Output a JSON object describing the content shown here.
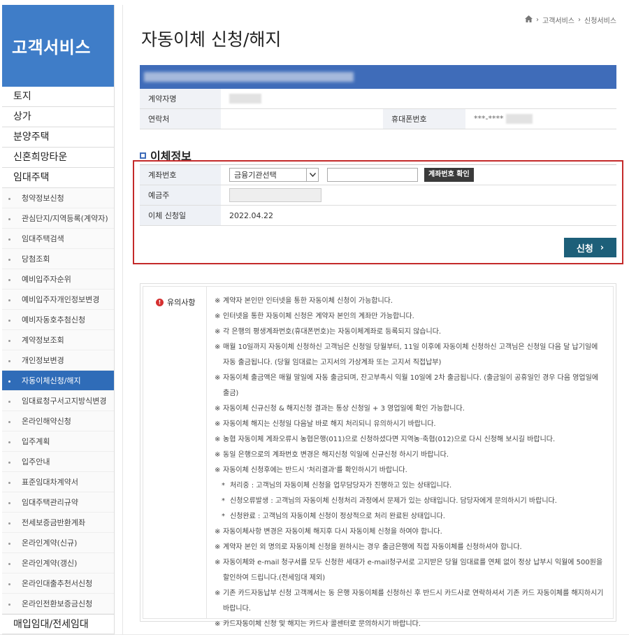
{
  "sidebar": {
    "title": "고객서비스",
    "main_items": [
      "토지",
      "상가",
      "분양주택",
      "신혼희망타운",
      "임대주택"
    ],
    "sub_items": [
      "청약정보신청",
      "관심단지/지역등록(계약자)",
      "임대주택검색",
      "당첨조회",
      "예비입주자순위",
      "예비입주자개인정보변경",
      "예비자동호추첨신청",
      "계약정보조회",
      "개인정보변경",
      "자동이체신청/해지",
      "임대료청구서고지방식변경",
      "온라인해약신청",
      "입주계획",
      "입주안내",
      "표준임대차계약서",
      "임대주택관리규약",
      "전세보증금반환계좌",
      "온라인계약(신규)",
      "온라인계약(갱신)",
      "온라인대출추천서신청",
      "온라인전환보증금신청"
    ],
    "active_sub": 9,
    "bottom_item": "매입임대/전세임대"
  },
  "breadcrumb": {
    "items": [
      "고객서비스",
      "신청서비스"
    ]
  },
  "page_title": "자동이체 신청/해지",
  "contract": {
    "name_label": "계약자명",
    "contact_label": "연락처",
    "mobile_label": "휴대폰번호",
    "mobile_value": "***-****"
  },
  "transfer": {
    "section_title": "이체정보",
    "account_label": "계좌번호",
    "bank_select": "금융기관선택",
    "verify_label": "계좌번호 확인",
    "holder_label": "예금주",
    "date_label": "이체 신청일",
    "date_value": "2022.04.22",
    "apply_label": "신청"
  },
  "notice": {
    "label": "유의사항",
    "items": [
      {
        "mark": "※",
        "text": "계약자 본인만 인터넷을 통한 자동이체 신청이 가능합니다."
      },
      {
        "mark": "※",
        "text": "인터넷을 통한 자동이체 신청은 계약자 본인의 계좌만 가능합니다."
      },
      {
        "mark": "※",
        "text": "각 은행의 평생계좌번호(휴대폰번호)는 자동이체계좌로 등록되지 않습니다."
      },
      {
        "mark": "※",
        "text": "매월 10일까지 자동이체 신청하신 고객님은 신청일 당월부터, 11일 이후에 자동이체 신청하신 고객님은 신청일 다음 달 납기일에 자동 출금됩니다. (당월 임대료는 고지서의 가상계좌 또는 고지서 직접납부)"
      },
      {
        "mark": "※",
        "text": "자동이체 출금액은 매월 말일에 자동 출금되며, 잔고부족시 익월 10일에 2차 출금됩니다. (출금일이 공휴일인 경우 다음 영업일에 출금)"
      },
      {
        "mark": "※",
        "text": "자동이체 신규신청 & 해지신청 결과는 통상 신청일 + 3 영업일에 확인 가능합니다."
      },
      {
        "mark": "※",
        "text": "자동이체 해지는 신청일 다음날 바로 해지 처리되니 유의하시기 바랍니다."
      },
      {
        "mark": "※",
        "text": "농협 자동이체 계좌오류시 농협은행(011)으로 신청하셨다면 지역농·축협(012)으로 다시 신청해 보시길 바랍니다."
      },
      {
        "mark": "※",
        "text": "동일 은행으로의 계좌번호 변경은 해지신청 익일에 신규신청 하시기 바랍니다."
      },
      {
        "mark": "※",
        "text": "자동이체 신청후에는 반드시 '처리결과'를 확인하시기 바랍니다."
      },
      {
        "mark": "*",
        "text": "처리중 : 고객님의 자동이체 신청을 업무담당자가 진행하고 있는 상태입니다.",
        "sub": true
      },
      {
        "mark": "*",
        "text": "신청오류발생 : 고객님의 자동이체 신청처리 과정에서 문제가 있는 상태입니다. 담당자에게 문의하시기 바랍니다.",
        "sub": true
      },
      {
        "mark": "*",
        "text": "신청완료 : 고객님의 자동이체 신청이 정상적으로 처리 완료된 상태입니다.",
        "sub": true
      },
      {
        "mark": "※",
        "text": "자동이체사항 변경은 자동이체 해지후 다시 자동이체 신청을 하여야 합니다."
      },
      {
        "mark": "※",
        "text": "계약자 본인 외 명의로 자동이체 신청을 원하시는 경우 출금은행에 직접 자동이체를 신청하셔야 합니다."
      },
      {
        "mark": "※",
        "text": "자동이체와 e-mail 청구서를 모두 신청한 세대가 e-mail청구서로 고지받은 당월 임대료를 연체 없이 정상 납부시 익월에 500원을 할인하여 드립니다.(전세임대 제외)"
      },
      {
        "mark": "※",
        "text": "기존 카드자동납부 신청 고객께서는 동 은행 자동이체를 신청하신 후 반드시 카드사로 연락하셔서 기존 카드 자동이체를 해지하시기 바랍니다."
      },
      {
        "mark": "※",
        "text": "카드자동이체 신청 및 해지는 카드사 콜센터로 문의하시기 바랍니다."
      }
    ]
  },
  "colors": {
    "brand": "#3f7dc8",
    "active": "#2f6cb8",
    "apply": "#1d5f79",
    "highlight": "#c42a2a"
  }
}
